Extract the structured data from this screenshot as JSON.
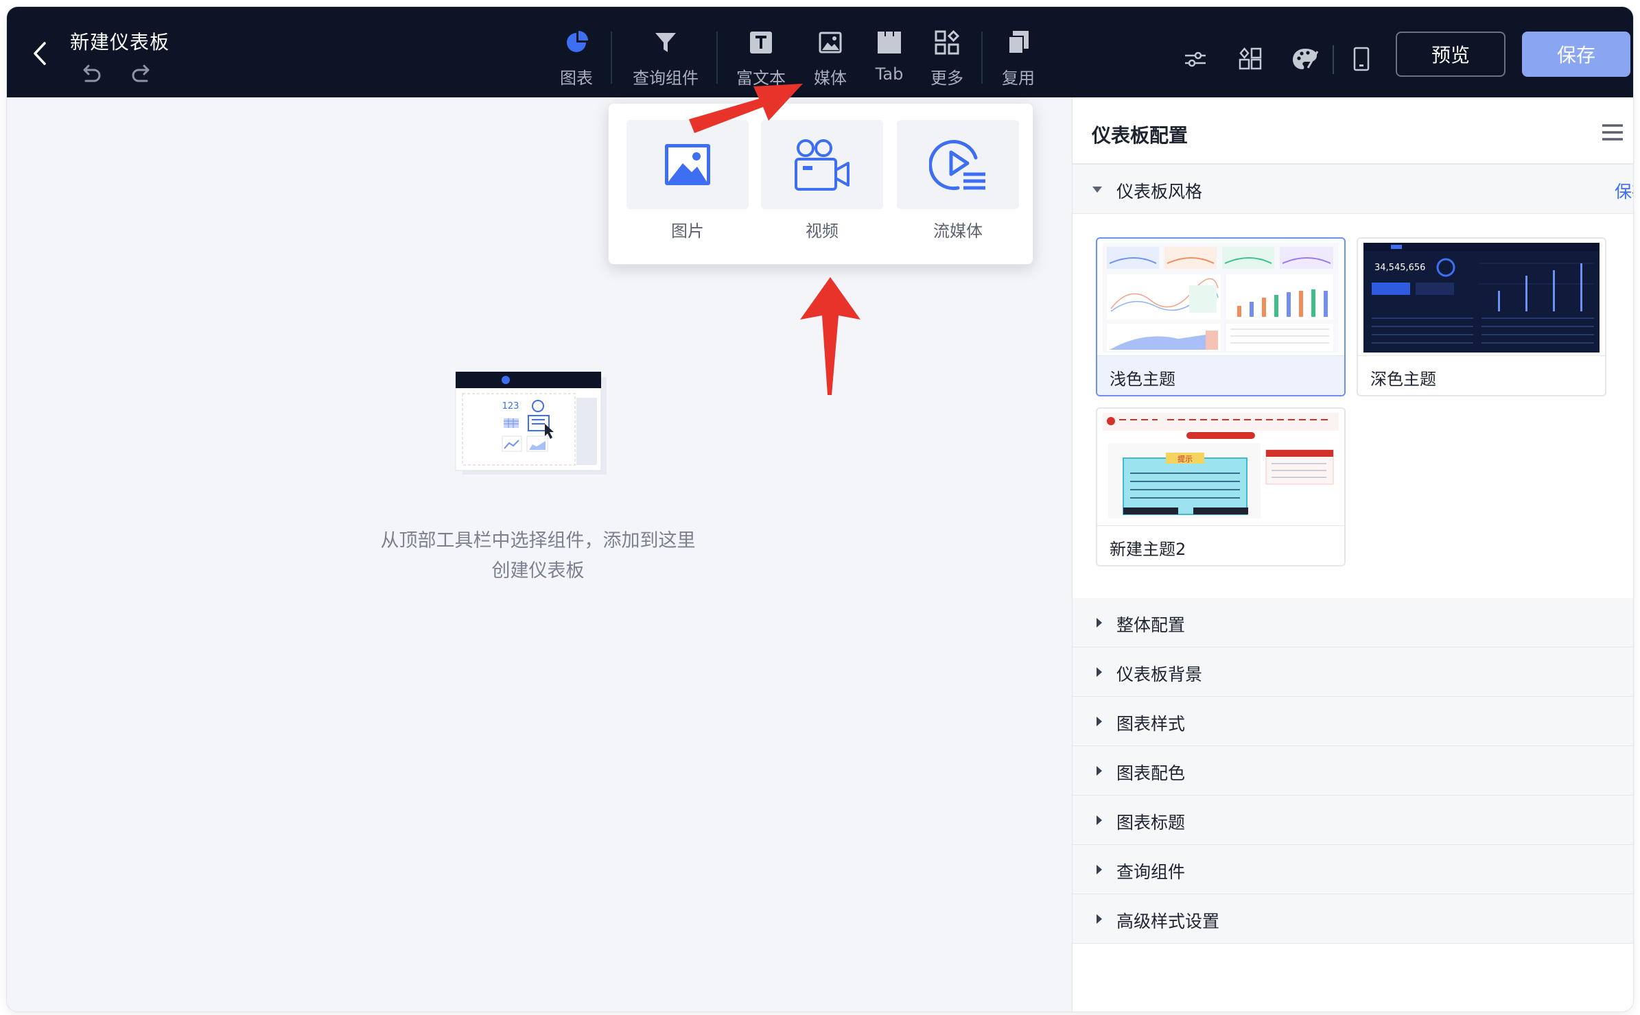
{
  "header": {
    "title": "新建仪表板",
    "tools": [
      {
        "label": "图表",
        "icon": "pie-chart-icon"
      },
      {
        "label": "查询组件",
        "icon": "filter-icon"
      },
      {
        "label": "富文本",
        "icon": "rich-text-icon"
      },
      {
        "label": "媒体",
        "icon": "image-icon"
      },
      {
        "label": "Tab",
        "icon": "tab-icon"
      },
      {
        "label": "更多",
        "icon": "more-grid-icon"
      },
      {
        "label": "复用",
        "icon": "copy-icon"
      }
    ],
    "preview_label": "预览",
    "save_label": "保存"
  },
  "canvas": {
    "empty_line1": "从顶部工具栏中选择组件，添加到这里",
    "empty_line2": "创建仪表板",
    "illustration_number": "123"
  },
  "media_popover": {
    "items": [
      {
        "label": "图片",
        "icon": "picture-icon"
      },
      {
        "label": "视频",
        "icon": "video-camera-icon"
      },
      {
        "label": "流媒体",
        "icon": "streaming-icon"
      }
    ]
  },
  "panel": {
    "title": "仪表板配置",
    "style_section": {
      "title": "仪表板风格",
      "save_label": "保存"
    },
    "themes": [
      {
        "name": "浅色主题",
        "selected": true
      },
      {
        "name": "深色主题",
        "selected": false
      },
      {
        "name": "新建主题2",
        "selected": false
      }
    ],
    "theme_preview_text": {
      "dark_kpi": "34,545,656",
      "custom_banner": "提示"
    },
    "sections": [
      "整体配置",
      "仪表板背景",
      "图表样式",
      "图表配色",
      "图表标题",
      "查询组件",
      "高级样式设置"
    ]
  },
  "colors": {
    "topbar_bg": "#0c1426",
    "accent": "#3e6ef2",
    "save_button": "#8aa6f0",
    "annotation_arrow": "#e8332a"
  }
}
